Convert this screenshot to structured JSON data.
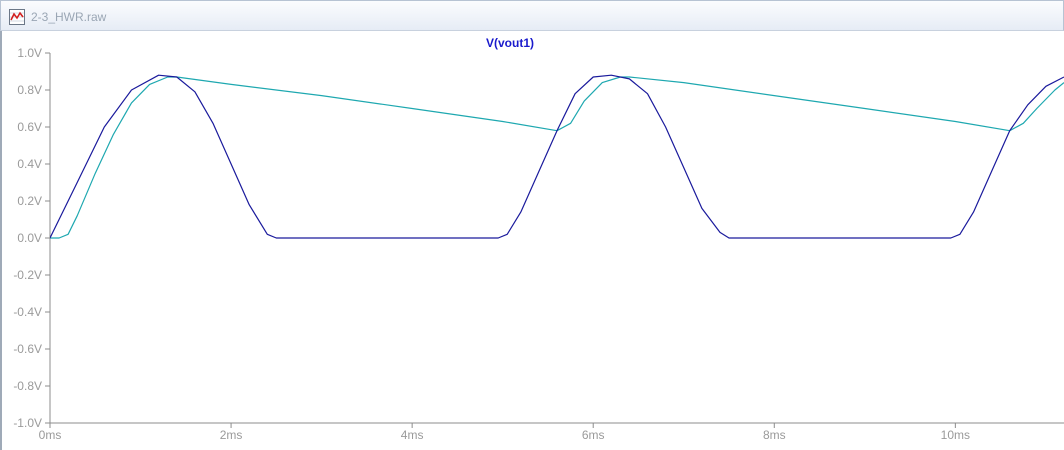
{
  "window": {
    "title": "2-3_HWR.raw",
    "icon": "waveform-icon"
  },
  "chart_data": {
    "type": "line",
    "title": "V(vout1)",
    "xlabel": "",
    "ylabel": "",
    "xlim": [
      0,
      11.2
    ],
    "ylim": [
      -1.0,
      1.0
    ],
    "grid": false,
    "x_unit": "ms",
    "y_unit": "V",
    "x_ticks": [
      0,
      2,
      4,
      6,
      8,
      10
    ],
    "x_tick_labels": [
      "0ms",
      "2ms",
      "4ms",
      "6ms",
      "8ms",
      "10ms"
    ],
    "y_ticks": [
      1.0,
      0.8,
      0.6,
      0.4,
      0.2,
      0.0,
      -0.2,
      -0.4,
      -0.6,
      -0.8,
      -1.0
    ],
    "y_tick_labels": [
      "1.0V",
      "0.8V",
      "0.6V",
      "0.4V",
      "0.2V",
      "0.0V",
      "-0.2V",
      "-0.4V",
      "-0.6V",
      "-0.8V",
      "-1.0V"
    ],
    "series": [
      {
        "color": "#1a1a9c",
        "x": [
          0,
          0.3,
          0.6,
          0.9,
          1.2,
          1.4,
          1.6,
          1.8,
          2.0,
          2.2,
          2.4,
          2.5,
          2.6,
          4.5,
          4.95,
          5.05,
          5.2,
          5.4,
          5.6,
          5.8,
          6.0,
          6.2,
          6.4,
          6.6,
          6.8,
          7.0,
          7.2,
          7.4,
          7.5,
          7.6,
          9.5,
          9.95,
          10.05,
          10.2,
          10.4,
          10.6,
          10.8,
          11.0,
          11.2
        ],
        "y": [
          0.0,
          0.3,
          0.6,
          0.8,
          0.88,
          0.87,
          0.79,
          0.62,
          0.4,
          0.18,
          0.02,
          0.0,
          0.0,
          0.0,
          0.0,
          0.02,
          0.14,
          0.36,
          0.58,
          0.78,
          0.87,
          0.88,
          0.86,
          0.78,
          0.6,
          0.38,
          0.16,
          0.03,
          0.0,
          0.0,
          0.0,
          0.0,
          0.02,
          0.14,
          0.36,
          0.58,
          0.72,
          0.82,
          0.87
        ]
      },
      {
        "color": "#1ea8b0",
        "x": [
          0,
          0.1,
          0.2,
          0.3,
          0.5,
          0.7,
          0.9,
          1.1,
          1.3,
          1.4,
          2.0,
          3.0,
          4.0,
          5.0,
          5.6,
          5.75,
          5.9,
          6.1,
          6.3,
          6.4,
          7.0,
          8.0,
          9.0,
          10.0,
          10.6,
          10.75,
          10.9,
          11.1,
          11.2
        ],
        "y": [
          0.0,
          0.0,
          0.02,
          0.12,
          0.35,
          0.56,
          0.73,
          0.83,
          0.87,
          0.87,
          0.83,
          0.77,
          0.7,
          0.63,
          0.58,
          0.62,
          0.74,
          0.84,
          0.87,
          0.87,
          0.84,
          0.77,
          0.7,
          0.63,
          0.58,
          0.62,
          0.7,
          0.8,
          0.84
        ]
      }
    ]
  }
}
